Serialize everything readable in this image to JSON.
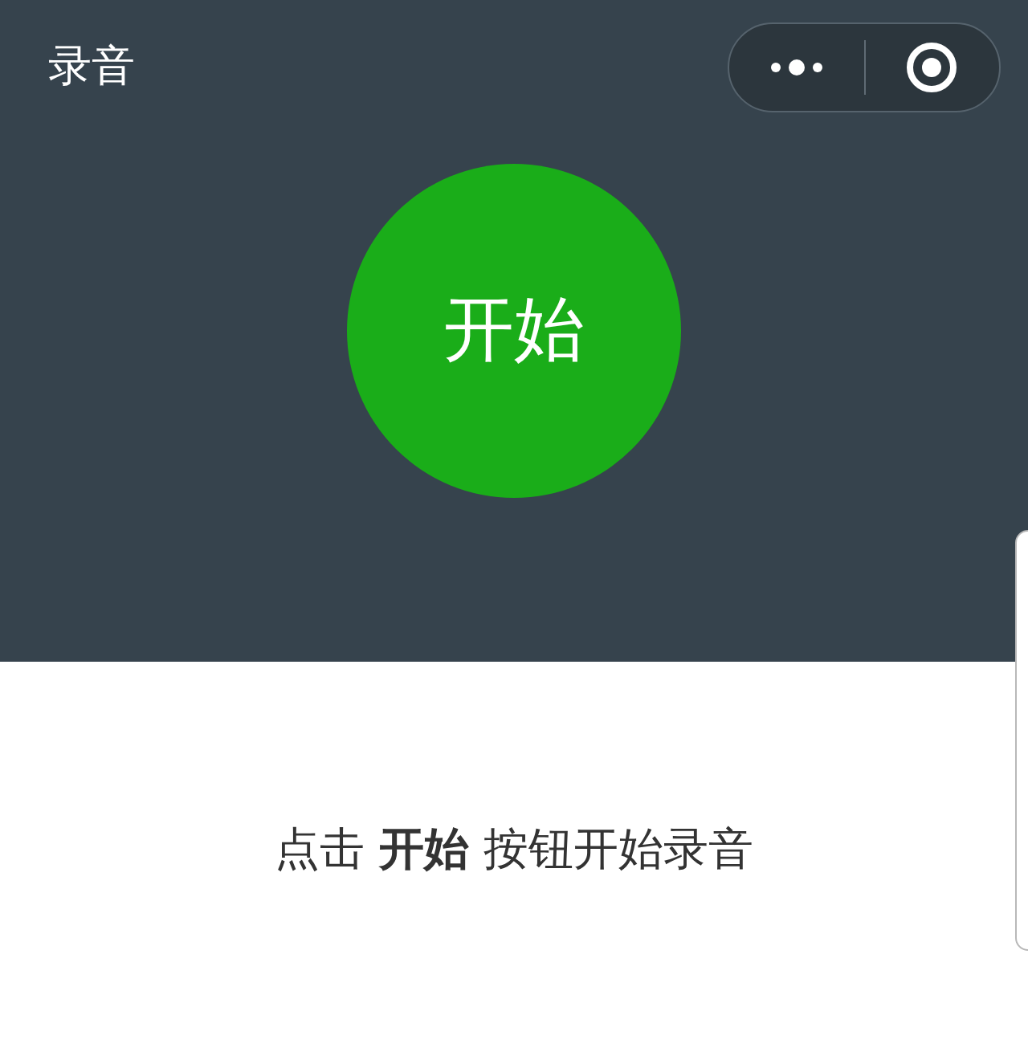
{
  "nav_bar": {
    "title": "录音"
  },
  "record_button": {
    "label": "开始"
  },
  "hint": "点击 **开始** 按钮开始录音"
}
